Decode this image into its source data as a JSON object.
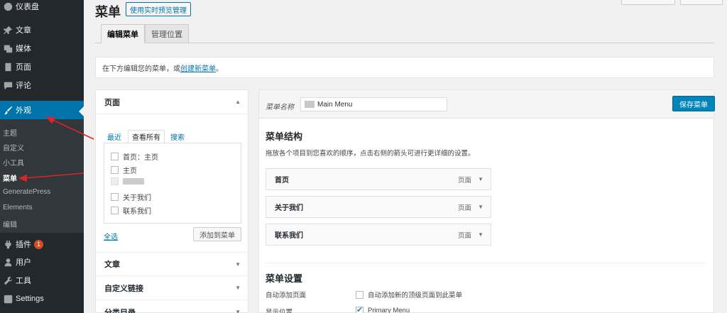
{
  "sidebar": {
    "items": [
      {
        "label": "仪表盘",
        "icon": "dashboard-icon"
      },
      {
        "label": "文章",
        "icon": "pin-icon"
      },
      {
        "label": "媒体",
        "icon": "media-icon"
      },
      {
        "label": "页面",
        "icon": "page-icon"
      },
      {
        "label": "评论",
        "icon": "comment-icon"
      },
      {
        "label": "外观",
        "icon": "brush-icon"
      },
      {
        "label": "插件",
        "icon": "plugin-icon",
        "badge": "1"
      },
      {
        "label": "用户",
        "icon": "user-icon"
      },
      {
        "label": "工具",
        "icon": "wrench-icon"
      },
      {
        "label": "Settings",
        "icon": "settings-icon"
      }
    ],
    "submenu": [
      "主题",
      "自定义",
      "小工具",
      "菜单",
      "GeneratePress",
      "Elements",
      "编辑"
    ],
    "accent": "#0073aa"
  },
  "header": {
    "title": "菜单",
    "preview_button": "使用实时预览管理"
  },
  "tabs": [
    {
      "label": "编辑菜单"
    },
    {
      "label": "管理位置"
    }
  ],
  "notice": {
    "text": "在下方编辑您的菜单，或",
    "link": "创建新菜单",
    "suffix": "。"
  },
  "accordion": {
    "pages": {
      "title": "页面",
      "tabs": [
        "最近",
        "查看所有",
        "搜索"
      ],
      "items": [
        "首页：主页",
        "主页",
        "关于我们",
        "联系我们"
      ],
      "select_all": "全选",
      "add_button": "添加到菜单"
    },
    "sections": [
      "文章",
      "自定义链接",
      "分类目录"
    ]
  },
  "editor": {
    "name_label": "菜单名称",
    "name_value": "Main Menu",
    "save_button": "保存菜单",
    "structure_title": "菜单结构",
    "structure_desc": "拖放各个项目到您喜欢的顺序，点击右侧的箭头可进行更详细的设置。",
    "items": [
      {
        "title": "首页",
        "type": "页面"
      },
      {
        "title": "关于我们",
        "type": "页面"
      },
      {
        "title": "联系我们",
        "type": "页面"
      }
    ],
    "settings_title": "菜单设置",
    "auto_add_label": "自动添加页面",
    "auto_add_option": "自动添加新的顶级页面到此菜单",
    "location_label": "显示位置",
    "location_option": "Primary Menu"
  },
  "annotation_color": "#d62728"
}
